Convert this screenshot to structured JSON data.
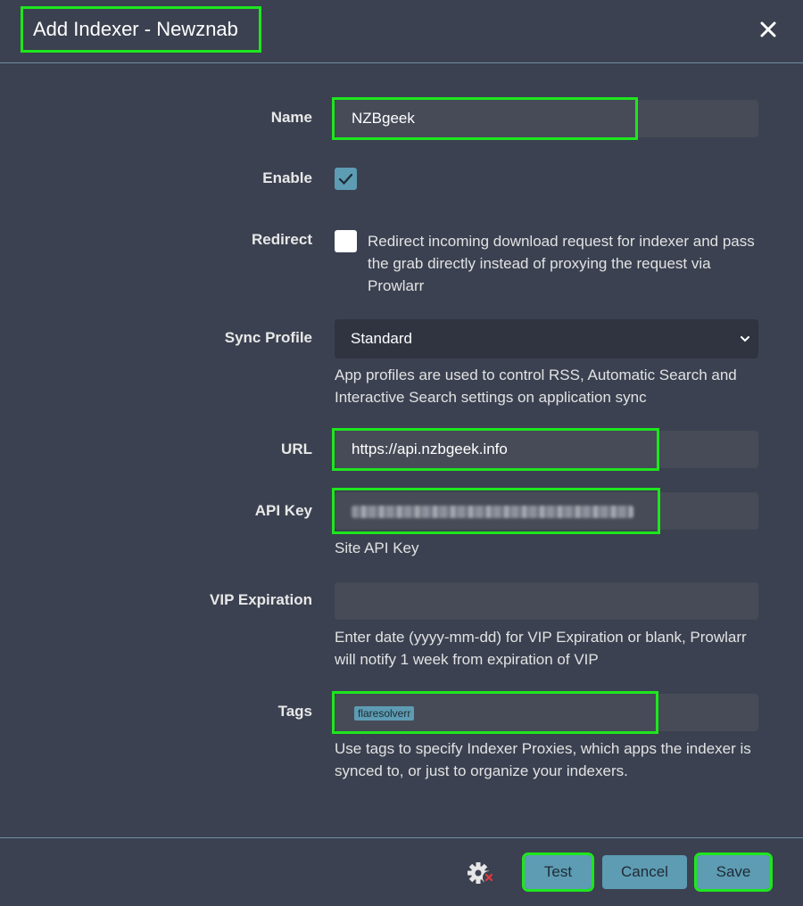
{
  "header": {
    "title": "Add Indexer - Newznab",
    "close_icon": "close-icon"
  },
  "form": {
    "name": {
      "label": "Name",
      "value": "NZBgeek"
    },
    "enable": {
      "label": "Enable",
      "checked": true
    },
    "redirect": {
      "label": "Redirect",
      "checked": false,
      "help": "Redirect incoming download request for indexer and pass the grab directly instead of proxying the request via Prowlarr"
    },
    "sync_profile": {
      "label": "Sync Profile",
      "value": "Standard",
      "help": "App profiles are used to control RSS, Automatic Search and Interactive Search settings on application sync"
    },
    "url": {
      "label": "URL",
      "value": "https://api.nzbgeek.info"
    },
    "api_key": {
      "label": "API Key",
      "help": "Site API Key"
    },
    "vip_expiration": {
      "label": "VIP Expiration",
      "value": "",
      "help": "Enter date (yyyy-mm-dd) for VIP Expiration or blank, Prowlarr will notify 1 week from expiration of VIP"
    },
    "tags": {
      "label": "Tags",
      "items": [
        "flaresolverr"
      ],
      "help": "Use tags to specify Indexer Proxies, which apps the indexer is synced to, or just to organize your indexers."
    }
  },
  "footer": {
    "test_label": "Test",
    "cancel_label": "Cancel",
    "save_label": "Save"
  },
  "colors": {
    "background": "#3b4150",
    "accent": "#5d9cb3",
    "highlight": "#1ee61e"
  }
}
